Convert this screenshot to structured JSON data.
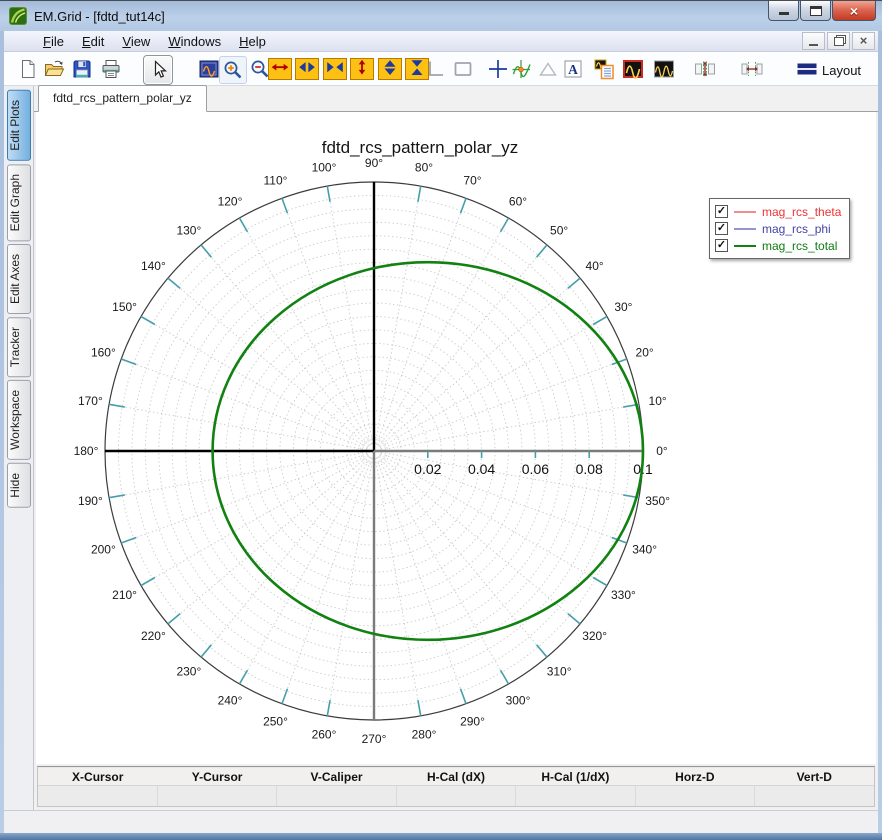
{
  "window": {
    "title": "EM.Grid - [fdtd_tut14c]",
    "controls": [
      "minimize",
      "maximize",
      "close"
    ],
    "mdi_controls": [
      "mdi-minimize",
      "mdi-restore",
      "mdi-close"
    ]
  },
  "menu": {
    "items": [
      "File",
      "Edit",
      "View",
      "Windows",
      "Help"
    ]
  },
  "toolbar": {
    "layout_label": "Layout",
    "items": [
      "new-document",
      "open-file",
      "save",
      "print",
      "pointer-tool",
      "zoom-fit",
      "zoom-in",
      "zoom-out",
      "expand-horizontal",
      "widen-horizontal",
      "shrink-horizontal",
      "expand-vertical",
      "widen-vertical",
      "shrink-vertical",
      "axes-corner",
      "zoom-box",
      "crosshair",
      "tracker",
      "triangle-marker",
      "text-annotation",
      "copy-plot-list",
      "plot-window",
      "multi-plot-window",
      "split-vertical",
      "split-horizontal",
      "layout"
    ]
  },
  "sidebar": {
    "tabs": [
      {
        "label": "Edit Plots",
        "active": true
      },
      {
        "label": "Edit Graph",
        "active": false
      },
      {
        "label": "Edit Axes",
        "active": false
      },
      {
        "label": "Tracker",
        "active": false
      },
      {
        "label": "Workspace",
        "active": false
      },
      {
        "label": "Hide",
        "active": false
      }
    ]
  },
  "doc_tabs": [
    {
      "label": "fdtd_rcs_pattern_polar_yz",
      "active": true
    }
  ],
  "legend": {
    "entries": [
      {
        "label": "mag_rcs_theta",
        "checked": true,
        "line_color": "#f28b8b",
        "text_color": "#ee3333"
      },
      {
        "label": "mag_rcs_phi",
        "checked": true,
        "line_color": "#9595cd",
        "text_color": "#4444a8"
      },
      {
        "label": "mag_rcs_total",
        "checked": true,
        "line_color": "#118211",
        "text_color": "#0e7e10"
      }
    ]
  },
  "status_bar": {
    "columns": [
      {
        "header": "X-Cursor",
        "value": ""
      },
      {
        "header": "Y-Cursor",
        "value": ""
      },
      {
        "header": "V-Caliper",
        "value": ""
      },
      {
        "header": "H-Cal (dX)",
        "value": ""
      },
      {
        "header": "H-Cal (1/dX)",
        "value": ""
      },
      {
        "header": "Horz-D",
        "value": ""
      },
      {
        "header": "Vert-D",
        "value": ""
      }
    ]
  },
  "chart_data": {
    "type": "polar",
    "title": "fdtd_rcs_pattern_polar_yz",
    "r_max": 0.1,
    "radial_ticks": [
      0.02,
      0.04,
      0.06,
      0.08,
      0.1
    ],
    "grid_ring_step": 0.005,
    "angle_tick_step_deg": 10,
    "angle_labels": [
      "0°",
      "10°",
      "20°",
      "30°",
      "40°",
      "50°",
      "60°",
      "70°",
      "80°",
      "90°",
      "100°",
      "110°",
      "120°",
      "130°",
      "140°",
      "150°",
      "160°",
      "170°",
      "180°",
      "190°",
      "200°",
      "210°",
      "220°",
      "230°",
      "240°",
      "250°",
      "260°",
      "270°",
      "280°",
      "290°",
      "300°",
      "310°",
      "320°",
      "330°",
      "340°",
      "350°"
    ],
    "grid": true,
    "legend_position": "upper-right",
    "series": [
      {
        "name": "mag_rcs_theta",
        "color": "#f28b8b",
        "visible_in_plot": false
      },
      {
        "name": "mag_rcs_phi",
        "color": "#9595cd",
        "visible_in_plot": false
      },
      {
        "name": "mag_rcs_total",
        "color": "#118211",
        "visible_in_plot": true,
        "shape": "offset_ellipse",
        "center_offset_x": 0.02,
        "rx": 0.08,
        "ry": 0.0702,
        "angles_deg": [
          0,
          30,
          60,
          90,
          120,
          150,
          180,
          210,
          240,
          270,
          300,
          330
        ],
        "values": [
          0.1,
          0.093,
          0.079,
          0.068,
          0.062,
          0.06,
          0.06,
          0.06,
          0.062,
          0.068,
          0.079,
          0.093
        ]
      }
    ]
  }
}
